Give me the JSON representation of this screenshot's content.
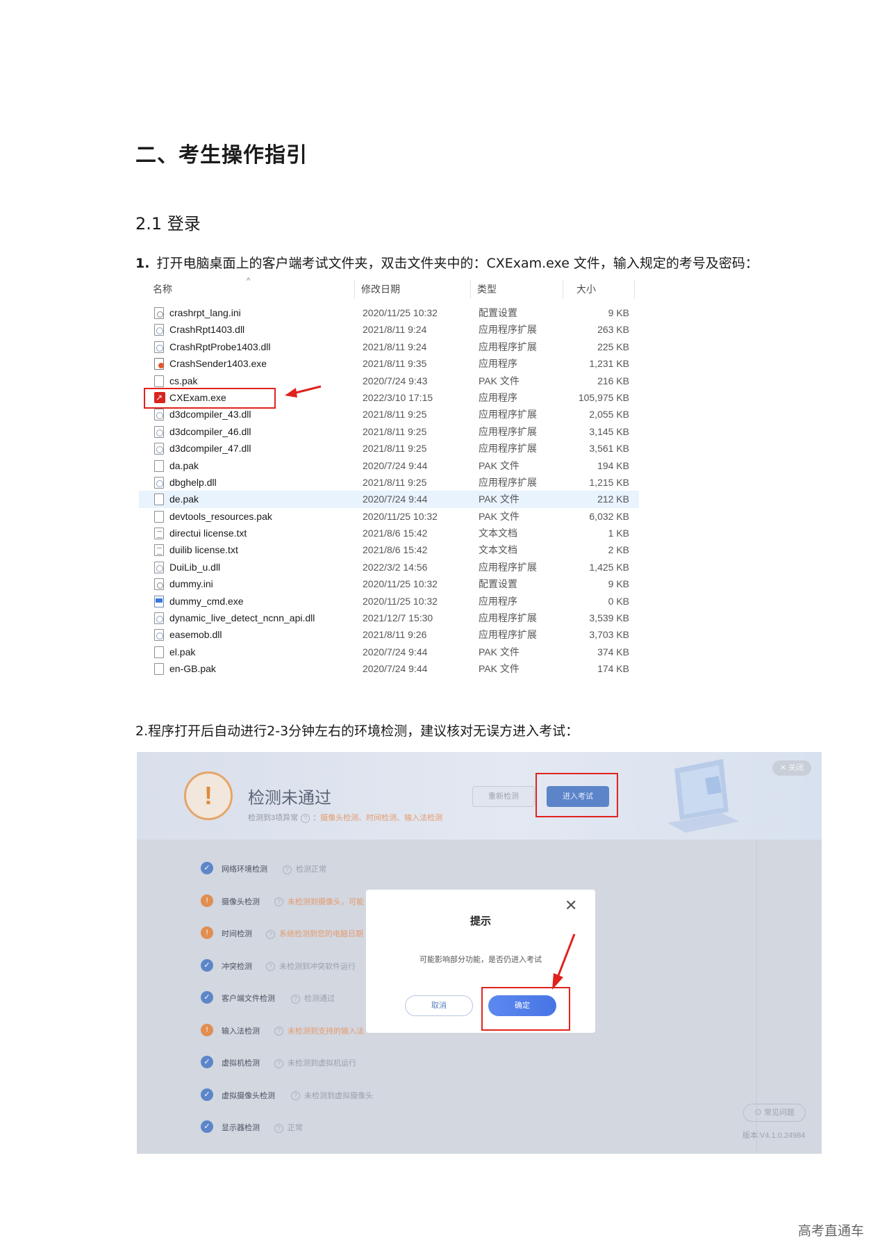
{
  "heading1": "二、考生操作指引",
  "heading2": "2.1 登录",
  "step1": {
    "number": "1.",
    "text": "打开电脑桌面上的客户端考试文件夹，双击文件夹中的：CXExam.exe 文件，输入规定的考号及密码："
  },
  "explorer": {
    "columns": {
      "name": "名称",
      "date": "修改日期",
      "type": "类型",
      "size": "大小"
    },
    "rows": [
      {
        "name": "crashrpt_lang.ini",
        "date": "2020/11/25 10:32",
        "type": "配置设置",
        "size": "9 KB",
        "icon": "ini-file-icon"
      },
      {
        "name": "CrashRpt1403.dll",
        "date": "2021/8/11 9:24",
        "type": "应用程序扩展",
        "size": "263 KB",
        "icon": "dll-file-icon"
      },
      {
        "name": "CrashRptProbe1403.dll",
        "date": "2021/8/11 9:24",
        "type": "应用程序扩展",
        "size": "225 KB",
        "icon": "dll-file-icon"
      },
      {
        "name": "CrashSender1403.exe",
        "date": "2021/8/11 9:35",
        "type": "应用程序",
        "size": "1,231 KB",
        "icon": "crash-sender-icon"
      },
      {
        "name": "cs.pak",
        "date": "2020/7/24 9:43",
        "type": "PAK 文件",
        "size": "216 KB",
        "icon": "file-icon"
      },
      {
        "name": "CXExam.exe",
        "date": "2022/3/10 17:15",
        "type": "应用程序",
        "size": "105,975 KB",
        "icon": "cxexam-app-icon"
      },
      {
        "name": "d3dcompiler_43.dll",
        "date": "2021/8/11 9:25",
        "type": "应用程序扩展",
        "size": "2,055 KB",
        "icon": "dll-file-icon"
      },
      {
        "name": "d3dcompiler_46.dll",
        "date": "2021/8/11 9:25",
        "type": "应用程序扩展",
        "size": "3,145 KB",
        "icon": "dll-file-icon"
      },
      {
        "name": "d3dcompiler_47.dll",
        "date": "2021/8/11 9:25",
        "type": "应用程序扩展",
        "size": "3,561 KB",
        "icon": "dll-file-icon"
      },
      {
        "name": "da.pak",
        "date": "2020/7/24 9:44",
        "type": "PAK 文件",
        "size": "194 KB",
        "icon": "file-icon"
      },
      {
        "name": "dbghelp.dll",
        "date": "2021/8/11 9:25",
        "type": "应用程序扩展",
        "size": "1,215 KB",
        "icon": "dll-file-icon"
      },
      {
        "name": "de.pak",
        "date": "2020/7/24 9:44",
        "type": "PAK 文件",
        "size": "212 KB",
        "icon": "file-icon"
      },
      {
        "name": "devtools_resources.pak",
        "date": "2020/11/25 10:32",
        "type": "PAK 文件",
        "size": "6,032 KB",
        "icon": "file-icon"
      },
      {
        "name": "directui license.txt",
        "date": "2021/8/6 15:42",
        "type": "文本文档",
        "size": "1 KB",
        "icon": "text-file-icon"
      },
      {
        "name": "duilib license.txt",
        "date": "2021/8/6 15:42",
        "type": "文本文档",
        "size": "2 KB",
        "icon": "text-file-icon"
      },
      {
        "name": "DuiLib_u.dll",
        "date": "2022/3/2 14:56",
        "type": "应用程序扩展",
        "size": "1,425 KB",
        "icon": "dll-file-icon"
      },
      {
        "name": "dummy.ini",
        "date": "2020/11/25 10:32",
        "type": "配置设置",
        "size": "9 KB",
        "icon": "ini-file-icon"
      },
      {
        "name": "dummy_cmd.exe",
        "date": "2020/11/25 10:32",
        "type": "应用程序",
        "size": "0 KB",
        "icon": "exe-file-icon"
      },
      {
        "name": "dynamic_live_detect_ncnn_api.dll",
        "date": "2021/12/7 15:30",
        "type": "应用程序扩展",
        "size": "3,539 KB",
        "icon": "dll-file-icon"
      },
      {
        "name": "easemob.dll",
        "date": "2021/8/11 9:26",
        "type": "应用程序扩展",
        "size": "3,703 KB",
        "icon": "dll-file-icon"
      },
      {
        "name": "el.pak",
        "date": "2020/7/24 9:44",
        "type": "PAK 文件",
        "size": "374 KB",
        "icon": "file-icon"
      },
      {
        "name": "en-GB.pak",
        "date": "2020/7/24 9:44",
        "type": "PAK 文件",
        "size": "174 KB",
        "icon": "file-icon"
      }
    ]
  },
  "step2": {
    "text": "2.程序打开后自动进行2-3分钟左右的环境检测，建议核对无误方进入考试："
  },
  "detector": {
    "title": "检测未通过",
    "subtitle_prefix": "检测到3项异常",
    "subtitle_issues": "摄像头检测、时间检测、输入法检测",
    "recheck_label": "重新检测",
    "enter_label": "进入考试",
    "close_label": "✕ 关闭",
    "checks": [
      {
        "label": "网络环境检测",
        "result": "检测正常",
        "status": "ok"
      },
      {
        "label": "摄像头检测",
        "result": "未检测到摄像头，可能",
        "status": "bad"
      },
      {
        "label": "时间检测",
        "result": "系统检测到您的电脑日期",
        "status": "bad"
      },
      {
        "label": "冲突检测",
        "result": "未检测到冲突软件运行",
        "status": "ok"
      },
      {
        "label": "客户端文件检测",
        "result": "检测通过",
        "status": "ok"
      },
      {
        "label": "输入法检测",
        "result": "未检测到支持的输入法",
        "status": "bad"
      },
      {
        "label": "虚拟机检测",
        "result": "未检测到虚拟机运行",
        "status": "ok"
      },
      {
        "label": "虚拟摄像头检测",
        "result": "未检测到虚拟摄像头",
        "status": "ok"
      },
      {
        "label": "显示器检测",
        "result": "正常",
        "status": "ok"
      }
    ],
    "faq_label": "常见问题",
    "version": "版本:V4.1.0.24984",
    "modal": {
      "title": "提示",
      "message": "可能影响部分功能，是否仍进入考试",
      "cancel_label": "取消",
      "ok_label": "确定"
    }
  },
  "footer": "高考直通车",
  "colors": {
    "highlight_red": "#e0221c",
    "accent_blue": "#4675e4",
    "warning_orange": "#e08e51"
  }
}
